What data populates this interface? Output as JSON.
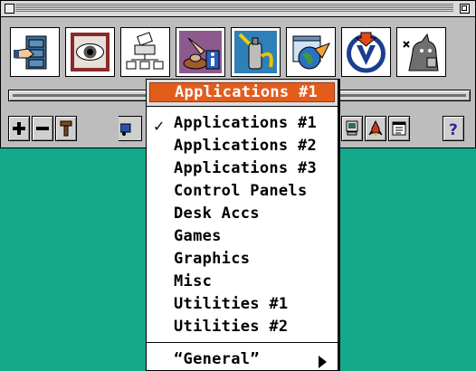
{
  "background_color": "#14a98a",
  "launcher": {
    "title_bar": {
      "close_box": "close-box",
      "zoom_box": "zoom-box"
    },
    "app_icons": [
      {
        "name": "file-cabinet-icon"
      },
      {
        "name": "eye-icon"
      },
      {
        "name": "network-scanner-icon"
      },
      {
        "name": "bowl-info-icon"
      },
      {
        "name": "spray-can-icon"
      },
      {
        "name": "globe-window-icon"
      },
      {
        "name": "v-download-icon"
      },
      {
        "name": "cat-gear-icon"
      }
    ],
    "small_buttons": [
      {
        "name": "plus-icon",
        "glyph": "+"
      },
      {
        "name": "minus-icon",
        "glyph": "−"
      },
      {
        "name": "hammer-icon"
      },
      {
        "name": "truck-icon"
      },
      {
        "name": "computer-icon"
      },
      {
        "name": "rocket-icon"
      },
      {
        "name": "window-list-icon"
      },
      {
        "name": "help-icon",
        "glyph": "?"
      }
    ]
  },
  "menu": {
    "selected_label": "Applications #1",
    "items": [
      "Applications #1",
      "Applications #2",
      "Applications #3",
      "Control Panels",
      "Desk Accs",
      "Games",
      "Graphics",
      "Misc",
      "Utilities #1",
      "Utilities #2"
    ],
    "checked_item": "Applications #1",
    "check_mark": "✓",
    "submenu_item": "“General”",
    "highlight_color": "#e35c1c"
  }
}
